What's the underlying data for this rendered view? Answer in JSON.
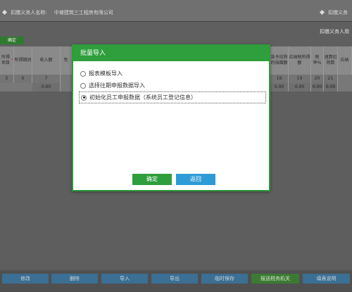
{
  "header": {
    "withholding_agent_label": "扣缴义务人名称:",
    "company_name": "中坡建筑三工程房有限公司",
    "right_label": "扣缴义务"
  },
  "subheader": {
    "right_text": "扣缴义务人用"
  },
  "confirm_tab_label": "确定",
  "table": {
    "headers": [
      "所得项目",
      "所得期间",
      "收入额",
      "免",
      "",
      "",
      "",
      "",
      "",
      "",
      "",
      "准予扣除的捐赠额",
      "应纳税所得额",
      "税率%",
      "速算扣除数",
      "应纳"
    ],
    "required_col_index": 0,
    "column_numbers": [
      "5",
      "6",
      "7",
      "",
      "",
      "",
      "",
      "",
      "",
      "",
      "",
      "18",
      "19",
      "20",
      "21",
      ""
    ],
    "values": [
      "",
      "",
      "0.00",
      "",
      "",
      "",
      "",
      "",
      "",
      "",
      "",
      "0.00",
      "0.00",
      "0.00",
      "0.00",
      ""
    ]
  },
  "dialog": {
    "title": "批量导入",
    "options": [
      {
        "label": "报表模板导入",
        "selected": false
      },
      {
        "label": "选择往期申报数据导入",
        "selected": false
      },
      {
        "label": "初始化员工申报数据（系统员工登记信息）",
        "selected": true
      }
    ],
    "ok_label": "确定",
    "back_label": "返回"
  },
  "bottom_buttons": [
    {
      "label": "修改"
    },
    {
      "label": "删除"
    },
    {
      "label": "导入"
    },
    {
      "label": "导出"
    },
    {
      "label": "临时保存"
    },
    {
      "label": "报送税务机关"
    },
    {
      "label": "填表说明"
    }
  ],
  "colors": {
    "dialog_green": "#2f9e3c",
    "back_blue": "#2e9bd6",
    "overlay_gray": "#5f5f5f"
  }
}
